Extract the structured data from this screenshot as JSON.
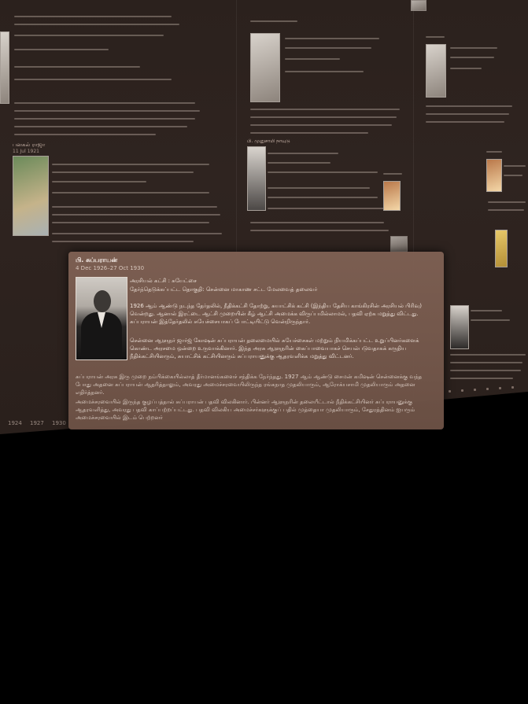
{
  "card": {
    "name": "பி. சுப்பராயன்",
    "dates": "4 Dec 1926–27 Oct 1930",
    "party": "அரசியல் கட்சி : சுயேட்சை",
    "constituency": "தேர்ந்தெடுக்கப்பட்ட தொகுதி: சென்னை மாகாண சட்ட மேலவைத் தலைவர்",
    "para1": "1926 ஆம் ஆண்டு நடந்த தேர்தலில், நீதிக்கட்சி தோற்று, சுயாட்சிக் கட்சி (இந்திய தேசிய காங்கிரசின் அரசியல் பிரிவு) வென்றது. ஆனால் இரட்டை ஆட்சி முறையின் கீழ் ஆட்சி அமைக்க விருப்பமில்லாமல், பதவி ஏற்க மறுத்து விட்டது. சுப்பராயன் இத்தேர்தலில் சுயேச்சையாகப் போட்டியிட்டு வென்றிருந்தார்.",
    "para2": "சென்னை ஆளுநர் ஜார்ஜ் கோஷன் சுப்பராயன் தலைமையில் சுயேச்சைகள் மற்றும் நியமிக்கப்பட்ட உறுப்பினர்களைக் கொண்ட அரசமை ஒன்றை உருவாக்கினார். இந்த அரசு ஆளுநரின் கைப்பாவையாகச் செயல்படுவதாகக் கருதிய நீதிக்கட்சியினரும், சுயாட்சிக் கட்சியினரும் சுப்பராயனுக்கு ஆதரவளிக்க மறுத்து விட்டனர்.",
    "para3": "சுப்பராயன் அரசு இரு முறை நம்பிக்கையில்லாத் தீர்மானங்களைச் சந்திக்க நேர்ந்தது. 1927 ஆம் ஆண்டு சைமன் கமிஷன் சென்னைக்கு வந்த போது அதனை சுப்பராயன் ஆதரித்தாலும், அவரது அமைச்சரவையிலிருந்த ரங்கநாத முதலியாரும், ஆரோக்யசாமி முதலியாரும் அதனை எதிர்த்தனர்.",
    "para4": "அமைச்சரவையில் இருந்த குழப்பத்தால் சுப்பராயன் பதவி விலகினார். பின்னர் ஆளுநரின் தலையீட்டால் நீதிக்கட்சியினர் சுப்பராயனுக்கு ஆதரவளித்து, அவரது பதவி காப்பற்றப்பட்டது. பதவி விலகிய அமைச்சர்களுக்குப் பதில் முத்தையா முதலியாரும், சேதுரத்தினம் ஐயரும் அமைச்சரவையில் இடம் பெற்றனர்"
  },
  "timeline": {
    "axis_labels": [
      "1924",
      "1927",
      "1930"
    ],
    "entry_titles": [
      "பனகல் ராஜா",
      "பி. சுப்பராயன்",
      "பி. முனுசாமி நாயுடு"
    ],
    "entry_dates": [
      "11 Jul 1921",
      "4 Dec 1926",
      "27 Oct 1930"
    ]
  },
  "colors": {
    "wall": "#2f2420",
    "card": "#7e6053",
    "background": "#000000"
  }
}
